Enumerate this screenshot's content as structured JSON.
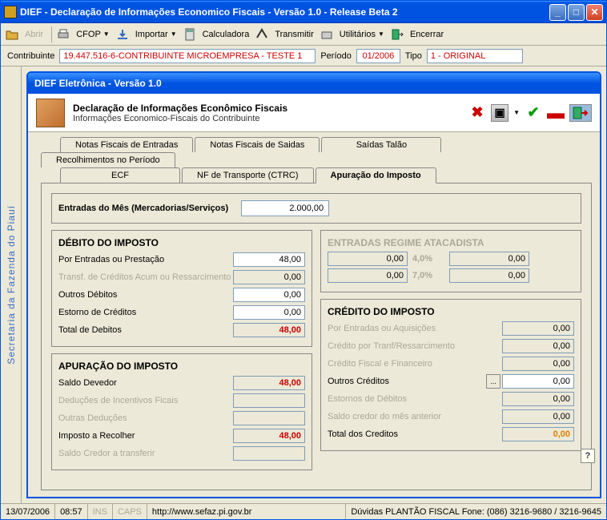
{
  "titlebar": "DIEF - Declaração de Informações Economico Fiscais - Versão 1.0 - Release Beta 2",
  "toolbar": {
    "abrir": "Abrir",
    "cfop": "CFOP",
    "importar": "Importar",
    "calculadora": "Calculadora",
    "transmitir": "Transmitir",
    "utilitarios": "Utilitários",
    "encerrar": "Encerrar"
  },
  "infobar": {
    "contrib_label": "Contribuinte",
    "contrib_value": "19.447.516-6-CONTRIBUINTE MICROEMPRESA - TESTE 1",
    "periodo_label": "Período",
    "periodo_value": "01/2006",
    "tipo_label": "Tipo",
    "tipo_value": "1 - ORIGINAL"
  },
  "sidebar": "Secretaria da Fazenda do Piauí",
  "inner_title": "DIEF Eletrônica - Versão 1.0",
  "header": {
    "title": "Declaração de Informações Econômico Fiscais",
    "sub": "Informações Economico-Fiscais do Contribuinte"
  },
  "tabs": {
    "nf_entradas": "Notas Fiscais de Entradas",
    "nf_saidas": "Notas Fiscais de Saidas",
    "saidas_talao": "Saídas Talão",
    "recolhimentos": "Recolhimentos no Período",
    "ecf": "ECF",
    "nf_transporte": "NF de Transporte (CTRC)",
    "apuracao": "Apuração do Imposto"
  },
  "entradas": {
    "label": "Entradas do Mês (Mercadorias/Serviços)",
    "value": "2.000,00"
  },
  "debito": {
    "title": "DÉBITO DO IMPOSTO",
    "por_entradas": "Por Entradas ou Prestação",
    "por_entradas_v": "48,00",
    "transf": "Transf. de Créditos Acum ou Ressarcimento",
    "transf_v": "0,00",
    "outros": "Outros Débitos",
    "outros_v": "0,00",
    "estorno": "Estorno de Créditos",
    "estorno_v": "0,00",
    "total": "Total de Debitos",
    "total_v": "48,00"
  },
  "apuracao_grp": {
    "title": "APURAÇÃO DO IMPOSTO",
    "saldo_dev": "Saldo Devedor",
    "saldo_dev_v": "48,00",
    "deducoes": "Deduções de Incentivos Ficais",
    "deducoes_v": "",
    "outras": "Outras Deduções",
    "outras_v": "",
    "recolher": "Imposto a Recolher",
    "recolher_v": "48,00",
    "saldo_cred": "Saldo Credor a transferir",
    "saldo_cred_v": ""
  },
  "atacad": {
    "title": "ENTRADAS REGIME ATACADISTA",
    "p1": "4,0%",
    "p2": "7,0%",
    "v1a": "0,00",
    "v1b": "0,00",
    "v2a": "0,00",
    "v2b": "0,00"
  },
  "credito": {
    "title": "CRÉDITO DO IMPOSTO",
    "por_entradas": "Por Entradas ou Aquisições",
    "por_entradas_v": "0,00",
    "cred_transf": "Crédito por Tranf/Ressarcimento",
    "cred_transf_v": "0,00",
    "cred_fisc": "Crédito Fiscal e Financeiro",
    "cred_fisc_v": "0,00",
    "outros": "Outros Créditos",
    "outros_v": "0,00",
    "estornos": "Estornos de Débitos",
    "estornos_v": "0,00",
    "saldo_ant": "Saldo credor do mês anterior",
    "saldo_ant_v": "0,00",
    "total": "Total dos Creditos",
    "total_v": "0,00"
  },
  "status": {
    "date": "13/07/2006",
    "time": "08:57",
    "ins": "INS",
    "caps": "CAPS",
    "url": "http://www.sefaz.pi.gov.br",
    "duvidas": "Dúvidas PLANTÃO FISCAL Fone: (086) 3216-9680 / 3216-9645"
  }
}
